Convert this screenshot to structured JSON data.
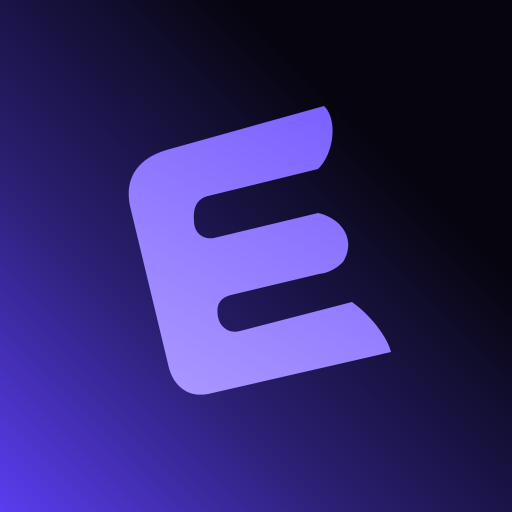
{
  "icon": {
    "name": "letter-e-logo-icon",
    "colors": {
      "background_dark": "#06050f",
      "background_mid": "#2a1f72",
      "background_accent": "#5a3df0",
      "logo_top": "#7c61ff",
      "logo_bottom": "#a996ff"
    }
  }
}
